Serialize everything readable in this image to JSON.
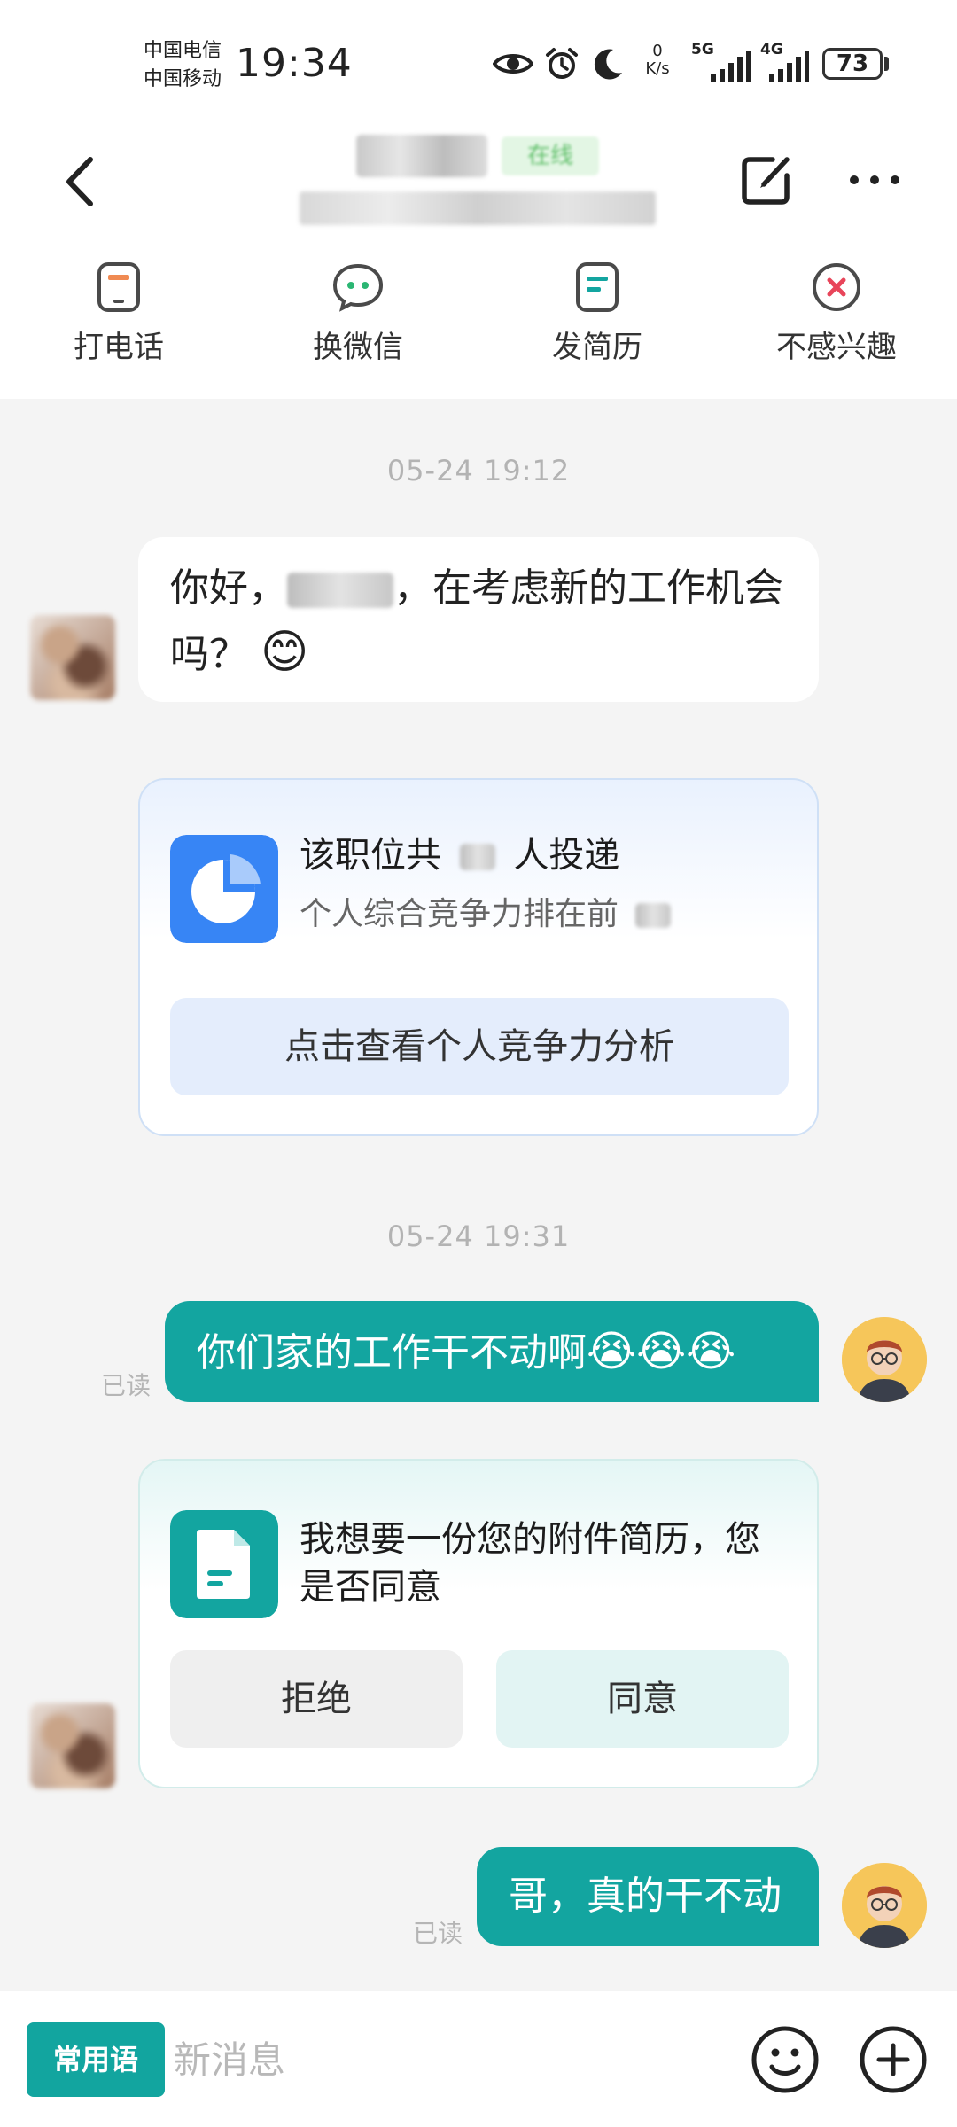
{
  "status_bar": {
    "carrier_1": "中国电信",
    "carrier_2": "中国移动",
    "time": "19:34",
    "net_speed_value": "0",
    "net_speed_unit": "K/s",
    "signal_1": "5G",
    "signal_2": "4G",
    "battery": "73"
  },
  "header": {
    "contact_status": "在线"
  },
  "actions": [
    {
      "label": "打电话",
      "icon": "phone-icon"
    },
    {
      "label": "换微信",
      "icon": "wechat-icon"
    },
    {
      "label": "发简历",
      "icon": "resume-icon"
    },
    {
      "label": "不感兴趣",
      "icon": "not-interested-icon"
    }
  ],
  "chat": {
    "timestamp_1": "05-24 19:12",
    "msg_1_part1": "你好，",
    "msg_1_part2": "，在考虑新的工作机会吗？",
    "msg_1_emoji": "😊",
    "competition_card": {
      "title_prefix": "该职位共",
      "title_suffix": "人投递",
      "subtitle_prefix": "个人综合竞争力排在前",
      "button": "点击查看个人竞争力分析"
    },
    "timestamp_2": "05-24 19:31",
    "msg_2_text": "你们家的工作干不动啊",
    "msg_2_emojis": "😭😭😭",
    "msg_2_read": "已读",
    "resume_card": {
      "title": "我想要一份您的附件简历，您是否同意",
      "reject": "拒绝",
      "agree": "同意"
    },
    "msg_3_text": "哥，真的干不动",
    "msg_3_read": "已读"
  },
  "input_bar": {
    "phrases_label": "常用语",
    "placeholder": "新消息"
  },
  "colors": {
    "accent": "#13a5a0",
    "blue_icon": "#3785f5"
  }
}
